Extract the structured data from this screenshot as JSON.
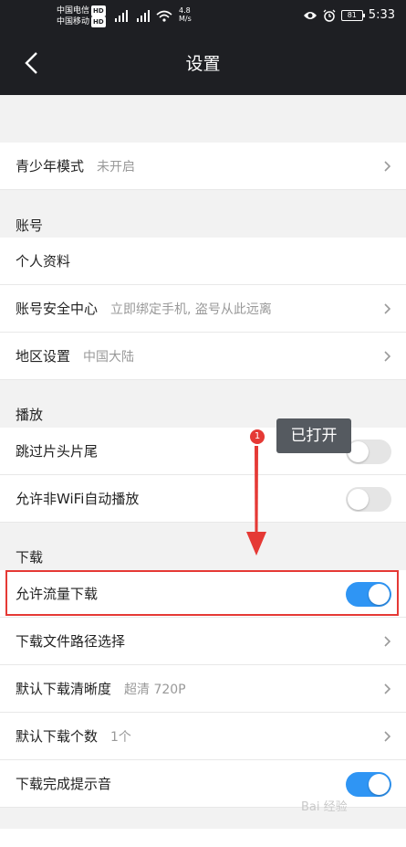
{
  "status_bar": {
    "carrier1": "中国电信",
    "carrier2": "中国移动",
    "hd": "HD",
    "net_speed_value": "4.8",
    "net_speed_unit": "M/s",
    "battery": "81",
    "time": "5:33"
  },
  "header": {
    "title": "设置"
  },
  "rows": {
    "youth": {
      "label": "青少年模式",
      "value": "未开启"
    },
    "personal": {
      "label": "个人资料"
    },
    "security": {
      "label": "账号安全中心",
      "value": "立即绑定手机, 盗号从此远离"
    },
    "region": {
      "label": "地区设置",
      "value": "中国大陆"
    },
    "skip": {
      "label": "跳过片头片尾",
      "toggle": "off"
    },
    "nonwifi": {
      "label": "允许非WiFi自动播放",
      "toggle": "off"
    },
    "cellular": {
      "label": "允许流量下载",
      "toggle": "on"
    },
    "path": {
      "label": "下载文件路径选择"
    },
    "quality": {
      "label": "默认下载清晰度",
      "value": "超清 720P"
    },
    "count": {
      "label": "默认下载个数",
      "value": "1个"
    },
    "done_sound": {
      "label": "下载完成提示音",
      "toggle": "on"
    }
  },
  "sections": {
    "account": "账号",
    "playback": "播放",
    "download": "下载"
  },
  "annotation": {
    "badge": "1",
    "callout": "已打开",
    "highlight_color": "#e53935"
  },
  "colors": {
    "toggle_on": "#2f95f4",
    "header_bg": "#1e1f23"
  },
  "watermark": "Bai 经验"
}
